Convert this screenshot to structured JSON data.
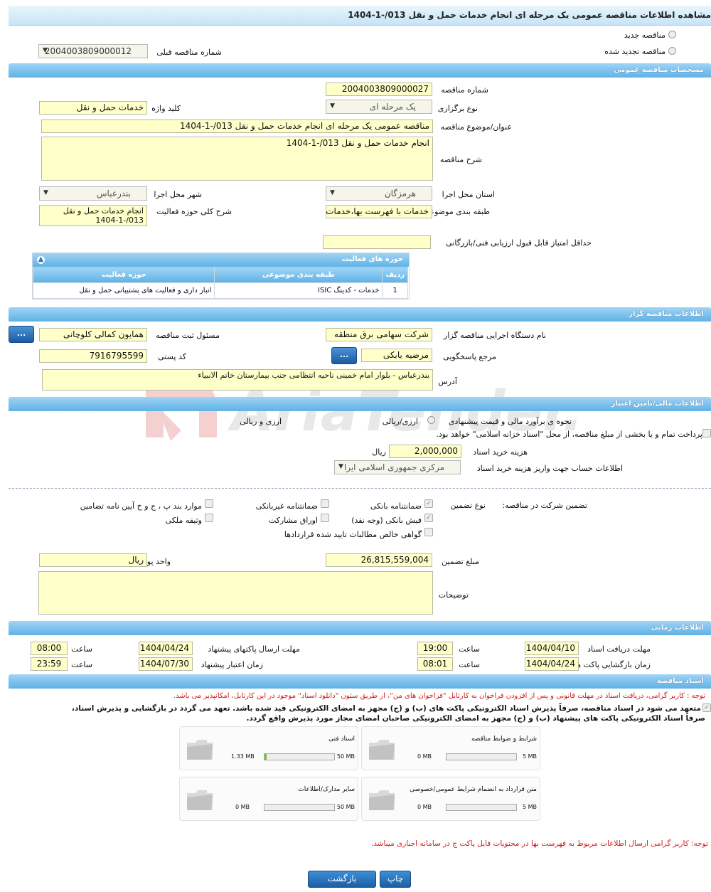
{
  "title": "مشاهده اطلاعات مناقصه عمومی یک مرحله ای انجام خدمات حمل و نقل 013/-1-1404",
  "top": {
    "new_tender": "مناقصه جدید",
    "renewed_tender": "مناقصه تجدید شده",
    "prev_number_label": "شماره مناقصه قبلی",
    "prev_number": "2004003809000012"
  },
  "general": {
    "header": "مشخصات مناقصه عمومی",
    "number_label": "شماره مناقصه",
    "number": "2004003809000027",
    "type_label": "نوع برگزاری",
    "type": "یک مرحله ای",
    "keyword_label": "کلید واژه",
    "keyword": "خدمات حمل و نقل",
    "subject_label": "عنوان/موضوع مناقصه",
    "subject": "مناقصه عمومی یک مرحله ای انجام خدمات حمل و نقل 013/-1-1404",
    "desc_label": "شرح مناقصه",
    "desc": "انجام خدمات حمل و نقل 013/-1-1404",
    "province_label": "استان محل اجرا",
    "province": "هرمزگان",
    "city_label": "شهر محل اجرا",
    "city": "بندرعباس",
    "category_label": "طبقه بندی موضوعی",
    "category": "خدمات با فهرست بها،خدمات",
    "activity_desc_label": "شرح کلی حوزه فعالیت",
    "activity_desc": "انجام خدمات حمل و نقل 013/-1-1404",
    "min_score_label": "حداقل امتیاز قابل قبول ارزیابی فنی/بازرگانی",
    "min_score": ""
  },
  "activity": {
    "header": "حوزه های فعالیت",
    "cols": [
      "ردیف",
      "طبقه بندی موضوعی",
      "حوزه فعالیت"
    ],
    "rows": [
      [
        "1",
        "خدمات - کدینگ ISIC",
        "انبار داری و فعالیت های پشتیبانی حمل و نقل"
      ]
    ]
  },
  "organizer": {
    "header": "اطلاعات مناقصه گزار",
    "org_label": "نام دستگاه اجرایی مناقصه گزار",
    "org": "شرکت سهامی برق منطقه",
    "resp_label": "مسئول ثبت مناقصه",
    "resp": "همایون کمالی کلوچانی",
    "ref_label": "مرجع پاسخگویی",
    "ref": "مرضیه بابکی",
    "postal_label": "کد پستی",
    "postal": "7916795599",
    "address_label": "آدرس",
    "address": "بندرعباس - بلوار امام خمینی ناحیه انتظامی جنب بیمارستان خاتم الانبیاء",
    "more": "..."
  },
  "finance": {
    "header": "اطلاعات مالی/تامین اعتبار",
    "estimate_label": "نحوه ی برآورد مالی و قیمت پیشنهادی",
    "opt1": "ارزی/ریالی",
    "opt2": "ارزی و ریالی",
    "treasury": "پرداخت تمام و یا بخشی از مبلغ مناقصه، از محل \"اسناد خزانه اسلامی\" خواهد بود.",
    "fee_label": "هزینه خرید اسناد",
    "fee": "2,000,000",
    "fee_unit": "ریال",
    "account_label": "اطلاعات حساب جهت واریز هزینه خرید اسناد",
    "account": "مرکزی جمهوری اسلامی ایرا"
  },
  "guarantee": {
    "label": "تضمین شرکت در مناقصه:",
    "type_label": "نوع تضمین",
    "items": [
      "ضمانتنامه بانکی",
      "ضمانتنامه غیربانکی",
      "موارد بند پ ، ج و خ آیین نامه تضامین",
      "فیش بانکی (وجه نقد)",
      "اوراق مشارکت",
      "وثیقه ملکی",
      "گواهی خالص مطالبات تایید شده قراردادها"
    ],
    "amount_label": "مبلغ تضمین",
    "amount": "26,815,559,004",
    "currency_label": "واحد پول",
    "currency": "ریال",
    "notes_label": "توضیحات",
    "notes": ""
  },
  "times": {
    "header": "اطلاعات زمانی",
    "receive_label": "مهلت دریافت اسناد",
    "receive_date": "1404/04/10",
    "receive_time": "19:00",
    "send_label": "مهلت ارسال پاکتهای پیشنهاد",
    "send_date": "1404/04/24",
    "send_time": "08:00",
    "open_label": "زمان بازگشایی پاکت ها",
    "open_date": "1404/04/24",
    "open_time": "08:01",
    "valid_label": "زمان اعتبار پیشنهاد",
    "valid_date": "1404/07/30",
    "valid_time": "23:59",
    "time_label": "ساعت"
  },
  "docs": {
    "header": "اسناد مناقصه",
    "note1": "توجه : کاربر گرامی، دریافت اسناد در مهلت قانونی و پس از افزودن فراخوان به کارتابل \"فراخوان های من\"، از طریق ستون \"دانلود اسناد\" موجود در این کارتابل، امکانپذیر می باشد.",
    "commit1": "متعهد می شود در اسناد مناقصه، صرفاً پذیرش اسناد الکترونیکی پاکت های (ب) و (ج) مجهز به امضای الکترونیکی قید شده باشد. تعهد می گردد در بازگشایی و پذیرش اسناد،",
    "commit2": "صرفاً اسناد الکترونیکی پاکت های پیشنهاد (ب) و (ج) مجهز به امضای الکترونیکی صاحبان امضای مجاز مورد پذیرش واقع گردد.",
    "files": [
      {
        "name": "شرایط و ضوابط مناقصه",
        "max": "5 MB",
        "cur": "0 MB",
        "fill": 0
      },
      {
        "name": "اسناد فنی",
        "max": "50 MB",
        "cur": "1.33 MB",
        "fill": 0.027
      },
      {
        "name": "متن قرارداد به انضمام شرایط عمومی/خصوصی",
        "max": "5 MB",
        "cur": "0 MB",
        "fill": 0
      },
      {
        "name": "سایر مدارک/اطلاعات",
        "max": "50 MB",
        "cur": "0 MB",
        "fill": 0
      }
    ],
    "note2": "توجه: کاربر گرامی ارسال اطلاعات مربوط به فهرست بها در محتویات فایل پاکت ج در سامانه اجباری میباشد."
  },
  "buttons": {
    "print": "چاپ",
    "back": "بازگشت"
  },
  "watermark": "AriaTender.neT"
}
